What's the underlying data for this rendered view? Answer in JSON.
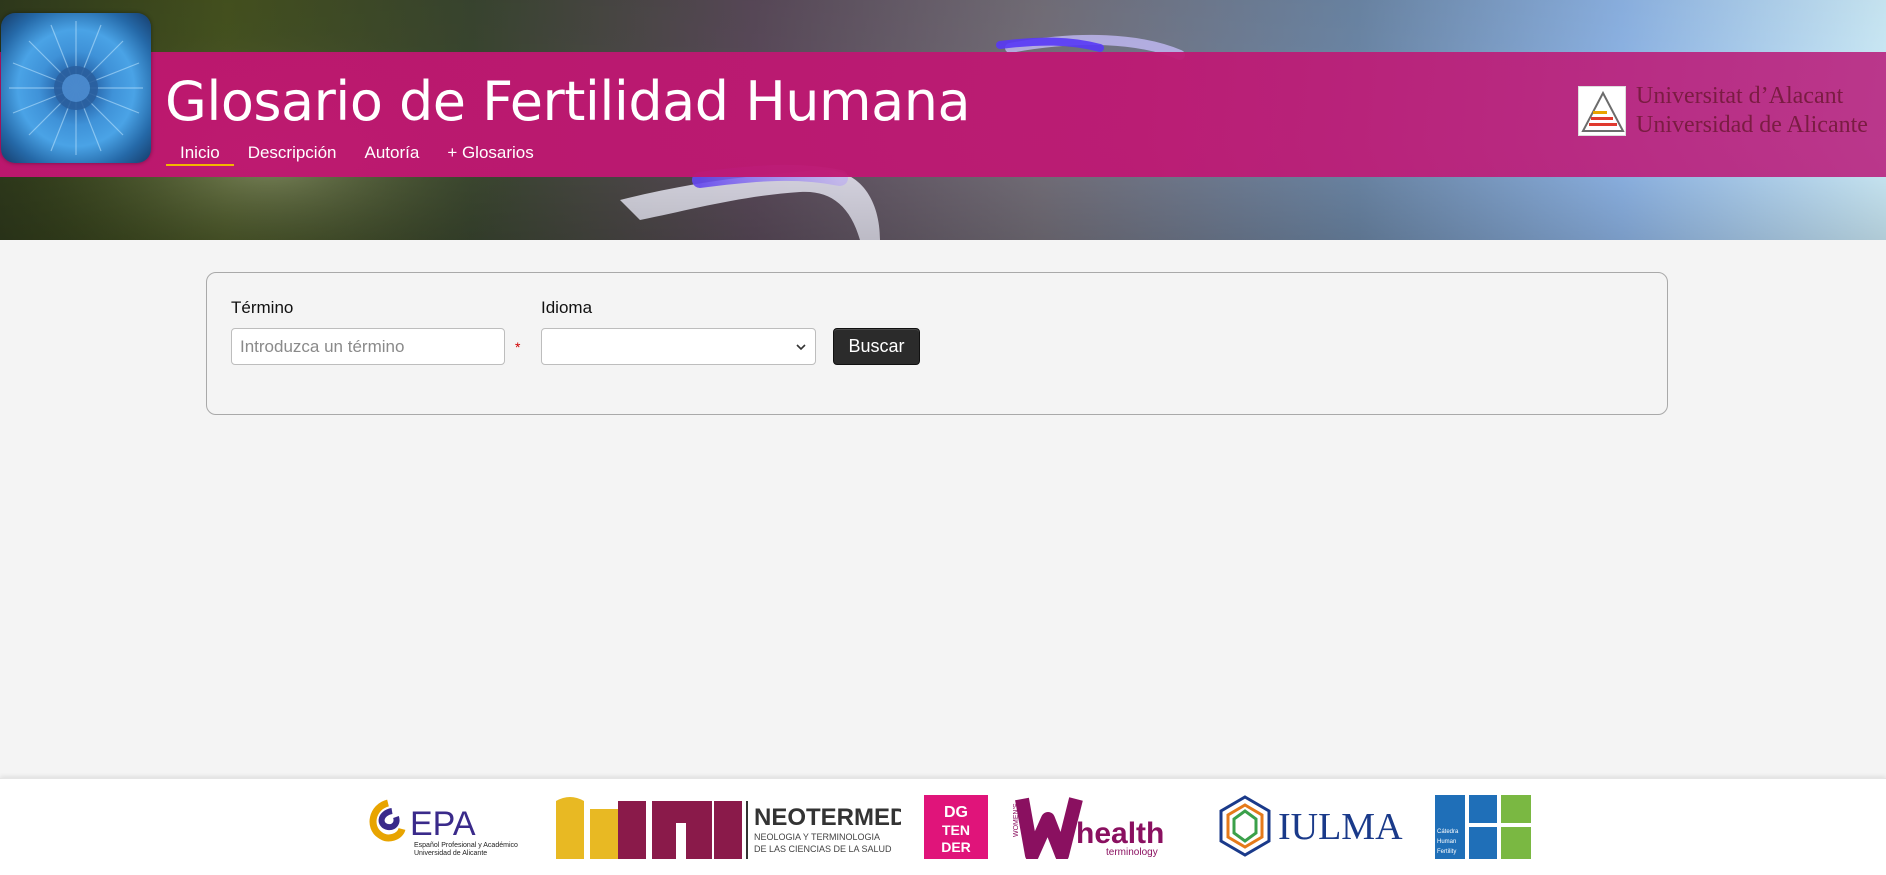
{
  "header": {
    "title": "Glosario de Fertilidad Humana",
    "nav": [
      {
        "label": "Inicio",
        "active": true
      },
      {
        "label": "Descripción",
        "active": false
      },
      {
        "label": "Autoría",
        "active": false
      },
      {
        "label": "+ Glosarios",
        "active": false
      }
    ],
    "university": {
      "line1": "Universitat d’Alacant",
      "line2": "Universidad de Alicante"
    }
  },
  "search": {
    "term_label": "Término",
    "term_placeholder": "Introduzca un término",
    "term_value": "",
    "required_marker": "*",
    "language_label": "Idioma",
    "language_value": "",
    "button_label": "Buscar"
  },
  "footer": {
    "sponsors": {
      "epa": {
        "name": "EPA",
        "subtitle_line1": "Español Profesional y Académico",
        "subtitle_line2": "Universidad de Alicante"
      },
      "neotermed": {
        "name": "NEOTERMED",
        "subtitle_line1": "NEOLOGIA Y TERMINOLOGIA",
        "subtitle_line2": "DE LAS CIENCIAS DE LA SALUD"
      },
      "dgtender": {
        "line1": "DG",
        "line2": "TEN",
        "line3": "DER"
      },
      "wh": {
        "vertical": "WOMEN'S",
        "name": "health",
        "subtitle": "terminology"
      },
      "iulma": {
        "name": "IULMA"
      },
      "catedra": {
        "line1": "Cátedra",
        "line2": "Human",
        "line3": "Fertility"
      }
    }
  },
  "colors": {
    "band": "#c01670",
    "nav_active_underline": "#f3b600",
    "button_bg": "#2b2b2b",
    "required": "#d00000"
  }
}
